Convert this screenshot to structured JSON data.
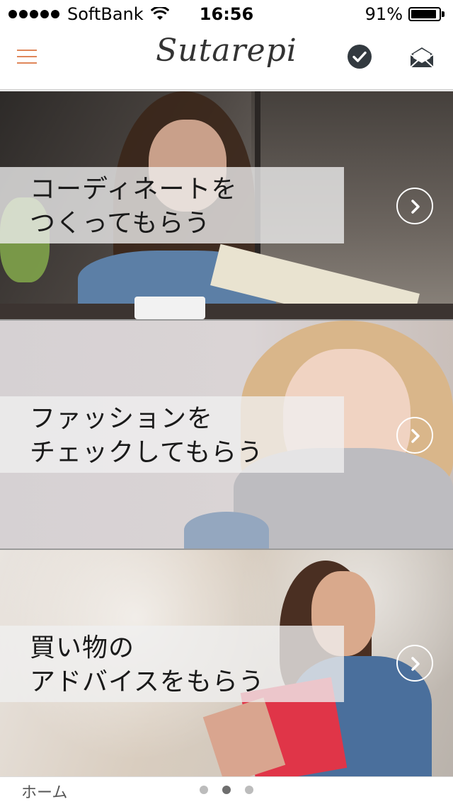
{
  "status_bar": {
    "carrier": "SoftBank",
    "time": "16:56",
    "battery_percent_label": "91%",
    "battery_level": 0.91
  },
  "nav": {
    "logo": "Sutarepi",
    "icons": [
      "menu-icon",
      "check-circle-icon",
      "mail-icon"
    ]
  },
  "banners": [
    {
      "line1": "コーディネートを",
      "line2": "つくってもらう"
    },
    {
      "line1": "ファッションを",
      "line2": "チェックしてもらう"
    },
    {
      "line1": "買い物の",
      "line2": "アドバイスをもらう"
    }
  ],
  "bottom_bar": {
    "home_label": "ホーム",
    "page_count": 3,
    "active_page": 2
  },
  "colors": {
    "accent": "#e0875a",
    "icon_dark": "#333a40"
  }
}
